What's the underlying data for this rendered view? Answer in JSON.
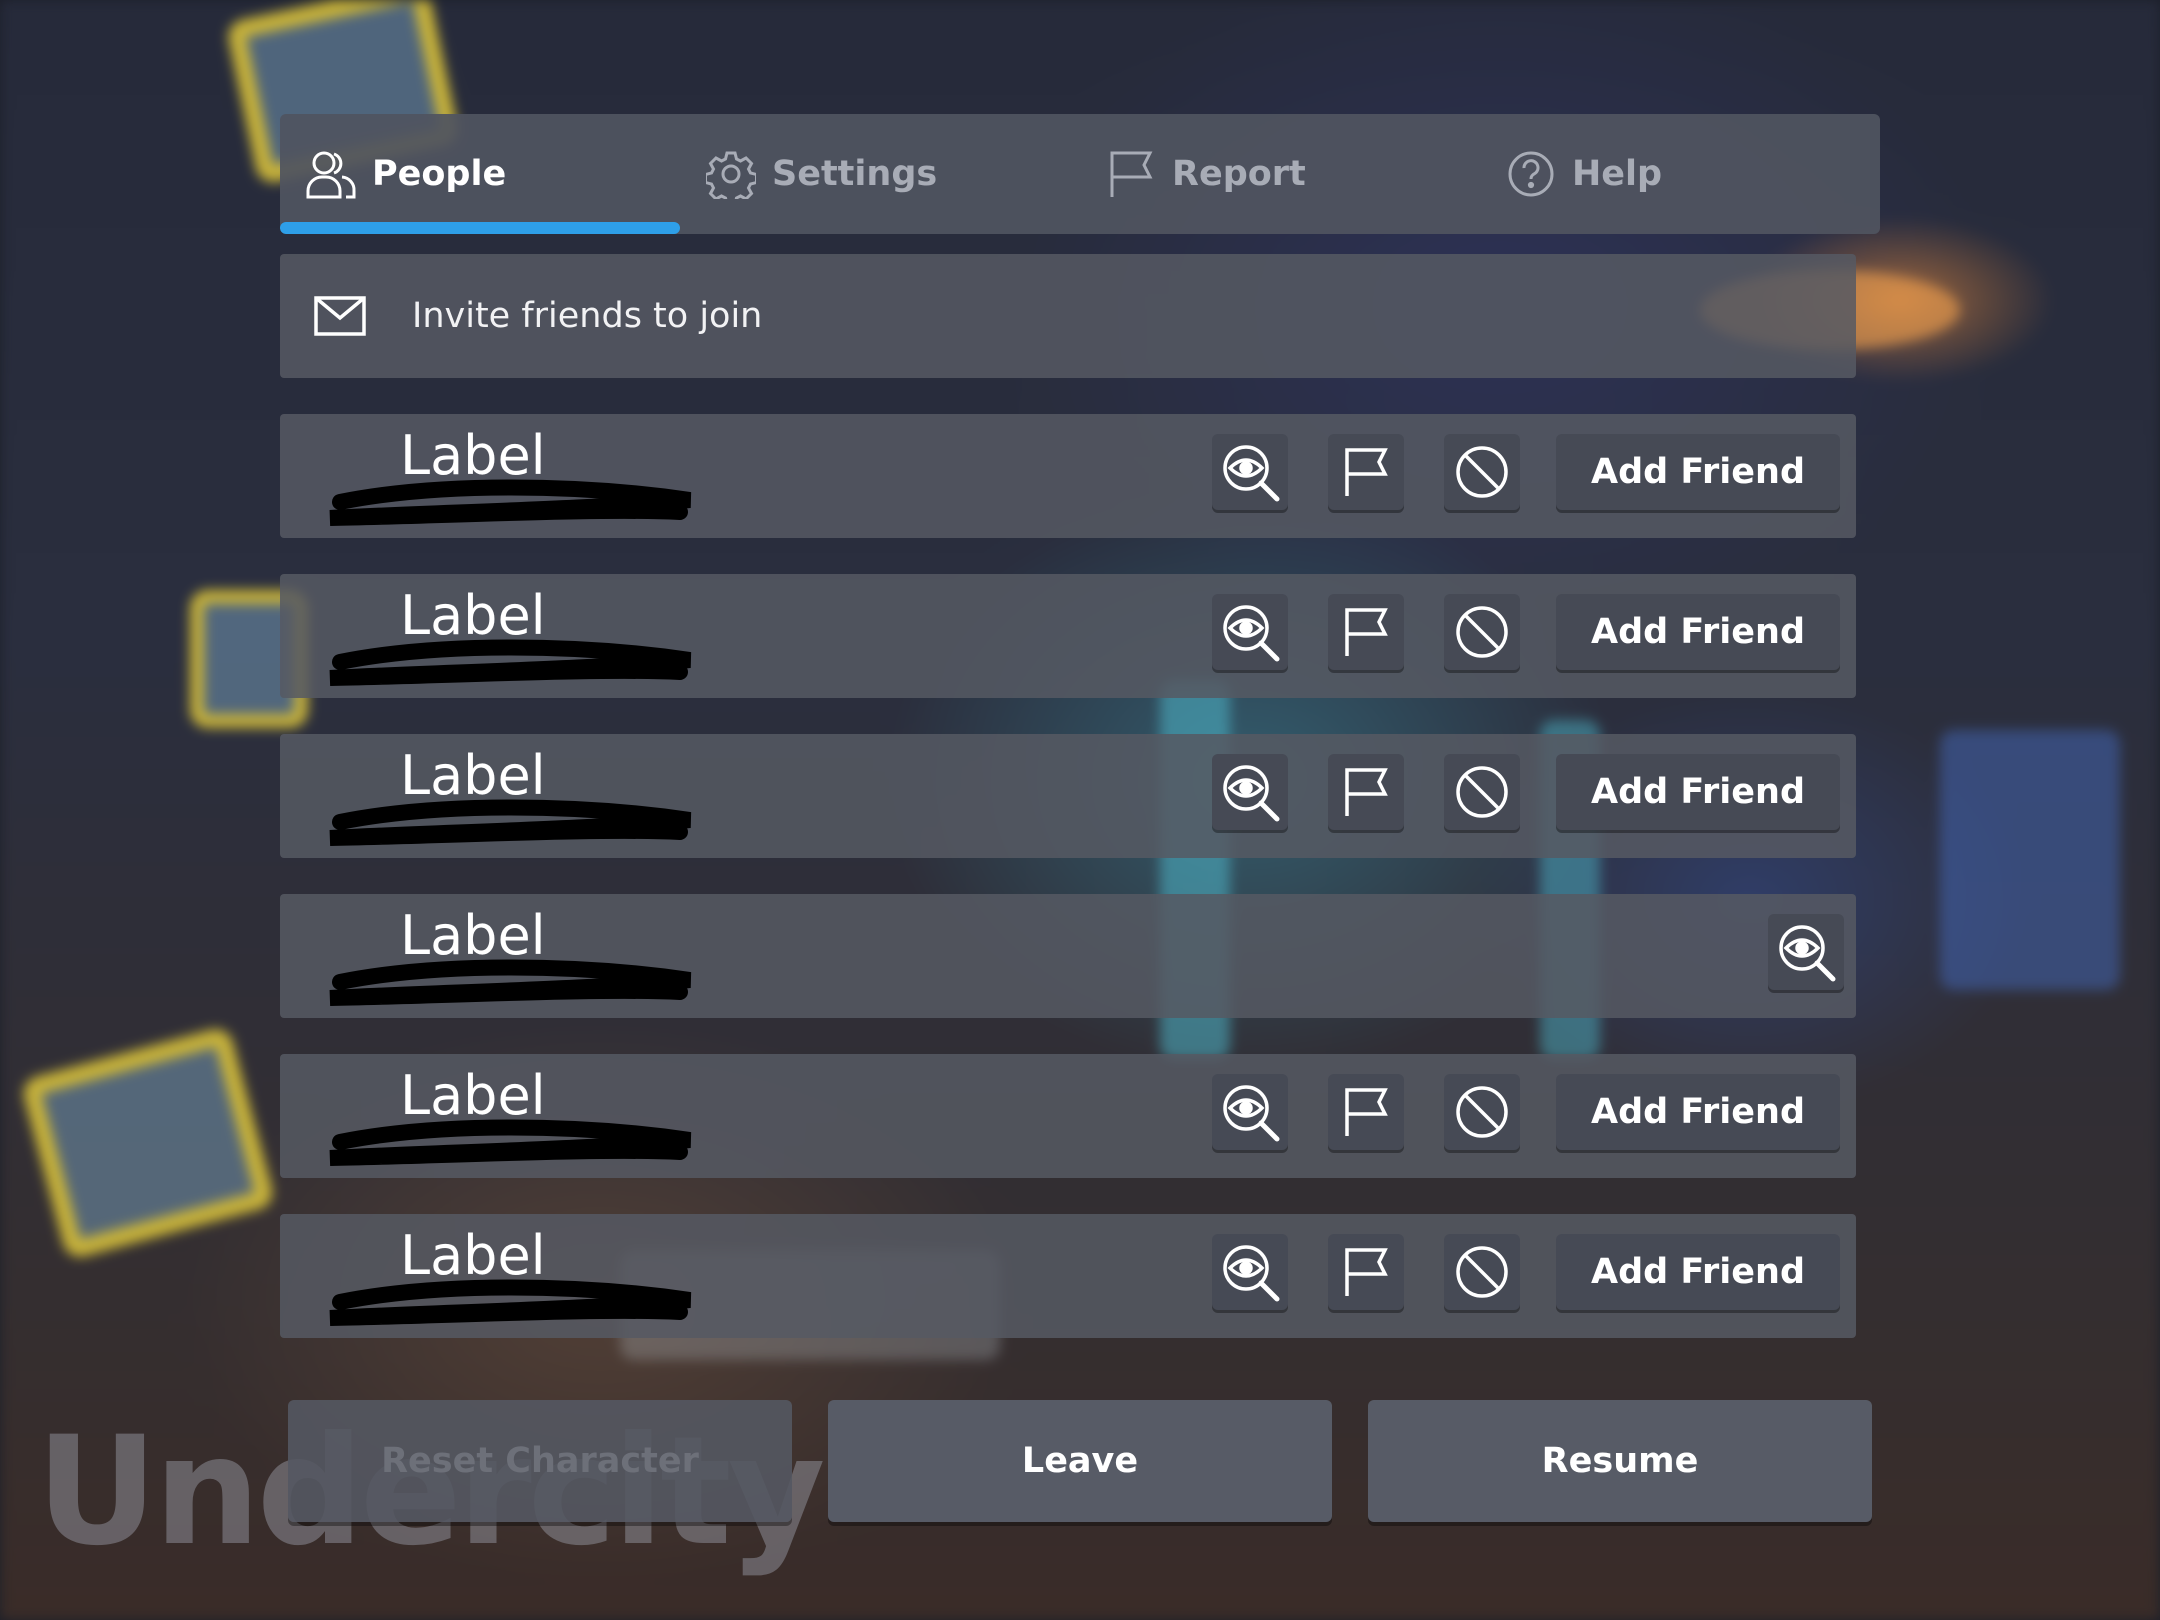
{
  "tabs": [
    {
      "label": "People",
      "icon": "people-icon",
      "active": true
    },
    {
      "label": "Settings",
      "icon": "gear-icon",
      "active": false
    },
    {
      "label": "Report",
      "icon": "flag-icon",
      "active": false
    },
    {
      "label": "Help",
      "icon": "help-icon",
      "active": false
    }
  ],
  "invite": {
    "label": "Invite friends to join",
    "icon": "mail-icon"
  },
  "players": [
    {
      "name": "Label",
      "add_friend_label": "Add Friend",
      "actions": [
        "inspect",
        "report",
        "block",
        "add-friend"
      ]
    },
    {
      "name": "Label",
      "add_friend_label": "Add Friend",
      "actions": [
        "inspect",
        "report",
        "block",
        "add-friend"
      ]
    },
    {
      "name": "Label",
      "add_friend_label": "Add Friend",
      "actions": [
        "inspect",
        "report",
        "block",
        "add-friend"
      ]
    },
    {
      "name": "Label",
      "actions": [
        "inspect"
      ]
    },
    {
      "name": "Label",
      "add_friend_label": "Add Friend",
      "actions": [
        "inspect",
        "report",
        "block",
        "add-friend"
      ]
    },
    {
      "name": "Label",
      "add_friend_label": "Add Friend",
      "actions": [
        "inspect",
        "report",
        "block",
        "add-friend"
      ]
    }
  ],
  "bottom": {
    "reset": {
      "label": "Reset Character",
      "enabled": false
    },
    "leave": {
      "label": "Leave",
      "enabled": true
    },
    "resume": {
      "label": "Resume",
      "enabled": true
    }
  },
  "watermark": "Undercity",
  "colors": {
    "accent": "#2e9fe8",
    "button": "#464a55",
    "panel": "#565963"
  }
}
